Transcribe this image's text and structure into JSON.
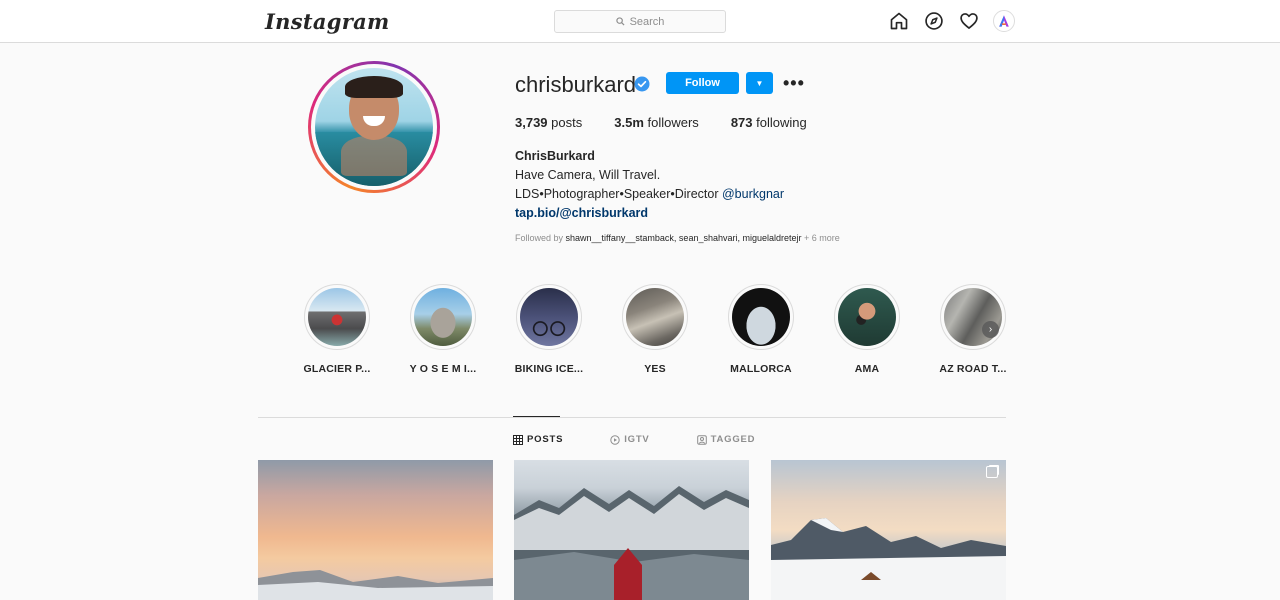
{
  "header": {
    "logo": "Instagram",
    "search_placeholder": "Search",
    "icons": [
      "home-icon",
      "explore-icon",
      "heart-icon",
      "avatar"
    ]
  },
  "profile": {
    "username": "chrisburkard",
    "verified": true,
    "follow_label": "Follow",
    "more_label": "•••",
    "stats": {
      "posts_count": "3,739",
      "posts_label": "posts",
      "followers_count": "3.5m",
      "followers_label": "followers",
      "following_count": "873",
      "following_label": "following"
    },
    "bio": {
      "name": "ChrisBurkard",
      "line1": "Have Camera, Will Travel.",
      "line2_text": "LDS•Photographer•Speaker•Director ",
      "line2_mention": "@burkgnar",
      "link": "tap.bio/@chrisburkard"
    },
    "followed_by": {
      "prefix": "Followed by ",
      "names": "shawn__tiffany__stamback, sean_shahvari, miguelaldretejr",
      "suffix": " + 6 more"
    }
  },
  "highlights": [
    {
      "label": "GLACIER P..."
    },
    {
      "label": "Y O S E M I..."
    },
    {
      "label": "BIKING ICE..."
    },
    {
      "label": "YES"
    },
    {
      "label": "MALLORCA"
    },
    {
      "label": "AMA"
    },
    {
      "label": "AZ ROAD T..."
    }
  ],
  "tabs": {
    "posts": "POSTS",
    "igtv": "IGTV",
    "tagged": "TAGGED"
  },
  "colors": {
    "accent": "#0095f6",
    "text": "#262626",
    "muted": "#8e8e8e",
    "border": "#dbdbdb",
    "background": "#fafafa"
  }
}
